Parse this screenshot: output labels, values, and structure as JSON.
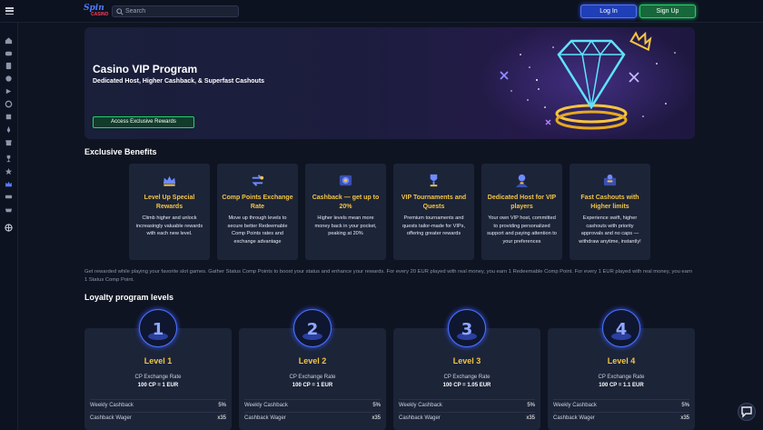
{
  "header": {
    "logo_line1": "Spin",
    "logo_line2": "CASINO",
    "search_placeholder": "Search",
    "login_label": "Log In",
    "signup_label": "Sign Up"
  },
  "sidebar": {
    "icons": [
      "home-icon",
      "games-icon",
      "cards-icon",
      "slots-icon",
      "live-icon",
      "roulette-icon",
      "jackpot-icon",
      "rocket-icon",
      "gift-icon",
      "trophy-icon",
      "crown-icon",
      "vip-icon",
      "promo-icon",
      "globe-icon"
    ]
  },
  "hero": {
    "title": "Casino VIP Program",
    "subtitle": "Dedicated Host, Higher Cashback, & Superfast Cashouts",
    "cta_label": "Access Exclusive Rewards"
  },
  "benefits_title": "Exclusive Benefits",
  "benefits": [
    {
      "title": "Level Up Special Rewards",
      "desc": "Climb higher and unlock increasingly valuable rewards with each new level.",
      "icon": "crown-icon"
    },
    {
      "title": "Comp Points Exchange Rate",
      "desc": "Move up through levels to secure better Redeemable Comp Points rates and exchange advantage",
      "icon": "exchange-icon"
    },
    {
      "title": "Cashback — get up to 20%",
      "desc": "Higher levels mean more money back in your pocket, peaking at 20%",
      "icon": "cashback-icon"
    },
    {
      "title": "VIP Tournaments and Quests",
      "desc": "Premium tournaments and quests tailor-made for VIPs, offering greater rewards",
      "icon": "trophy-icon"
    },
    {
      "title": "Dedicated Host for VIP players",
      "desc": "Your own VIP host, committed to providing personalized support and paying attention to your preferences",
      "icon": "host-icon"
    },
    {
      "title": "Fast Cashouts with Higher limits",
      "desc": "Experience swift, higher cashouts with priority approvals and no caps — withdraw anytime, instantly!",
      "icon": "cashout-icon"
    }
  ],
  "note": "Get rewarded while playing your favorite slot games. Gather Status Comp Points to boost your status and enhance your rewards. For every 20 EUR played with real money, you earn 1 Redeemable Comp Point. For every 1 EUR played with real money, you earn 1 Status Comp Point.",
  "levels_title": "Loyalty program levels",
  "levels": [
    {
      "name": "Level 1",
      "cp_label": "CP Exchange Rate",
      "cp_value": "100 CP = 1 EUR",
      "rows": [
        {
          "k": "Weekly Cashback",
          "v": "5%"
        },
        {
          "k": "Cashback Wager",
          "v": "x35"
        }
      ]
    },
    {
      "name": "Level 2",
      "cp_label": "CP Exchange Rate",
      "cp_value": "100 CP = 1 EUR",
      "rows": [
        {
          "k": "Weekly Cashback",
          "v": "5%"
        },
        {
          "k": "Cashback Wager",
          "v": "x35"
        }
      ]
    },
    {
      "name": "Level 3",
      "cp_label": "CP Exchange Rate",
      "cp_value": "100 CP = 1.05 EUR",
      "rows": [
        {
          "k": "Weekly Cashback",
          "v": "5%"
        },
        {
          "k": "Cashback Wager",
          "v": "x35"
        }
      ]
    },
    {
      "name": "Level 4",
      "cp_label": "CP Exchange Rate",
      "cp_value": "100 CP = 1.1 EUR",
      "rows": [
        {
          "k": "Weekly Cashback",
          "v": "5%"
        },
        {
          "k": "Cashback Wager",
          "v": "x35"
        }
      ]
    }
  ],
  "level_medal_numbers": [
    "1",
    "2",
    "3",
    "4"
  ],
  "colors": {
    "accent_gold": "#f5c542",
    "login_blue": "#1f3fb8",
    "signup_green": "#16683a",
    "card_bg": "#1c2438",
    "page_bg": "#0f1422"
  }
}
